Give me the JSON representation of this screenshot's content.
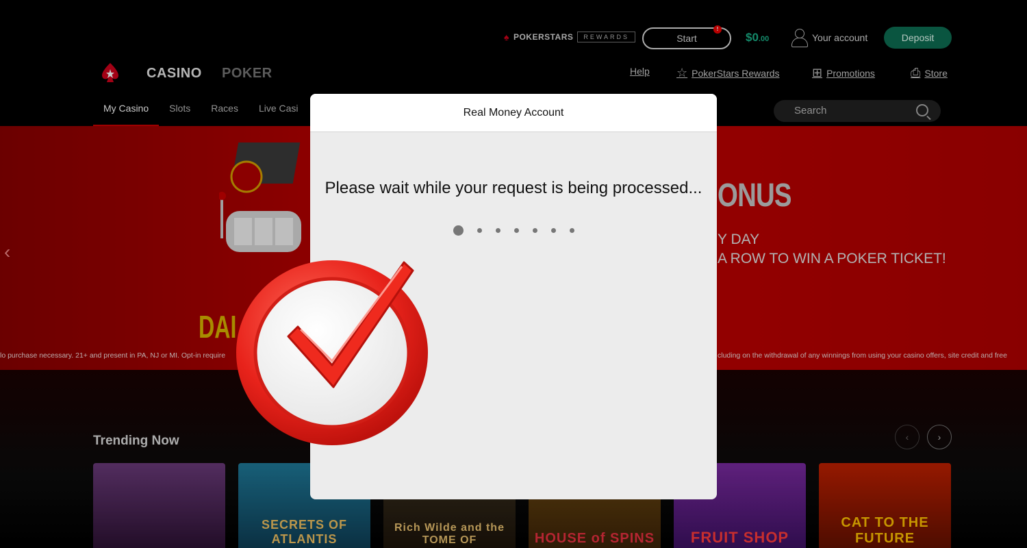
{
  "header": {
    "brand": "POKERSTARS",
    "brand_tag": "REWARDS",
    "start_label": "Start",
    "start_badge": "!",
    "balance_main": "$0",
    "balance_cents": ".00",
    "account_label": "Your account",
    "deposit_label": "Deposit"
  },
  "nav": {
    "casino": "CASINO",
    "poker": "POKER",
    "links": [
      "Help",
      "PokerStars Rewards",
      "Promotions",
      "Store"
    ]
  },
  "subnav": {
    "items": [
      "My Casino",
      "Slots",
      "Races",
      "Live Casi"
    ],
    "search_placeholder": "Search"
  },
  "banner": {
    "heading_partial": "ONUS",
    "line1": "Y DAY",
    "line2": "A ROW TO WIN A POKER TICKET!",
    "daily_partial": "DAI",
    "disclaimer_left": "lo purchase necessary. 21+ and present in PA, NJ or MI. Opt-in require",
    "disclaimer_right": "cluding on the withdrawal of any winnings from using your casino offers, site credit and free"
  },
  "trending": {
    "title": "Trending Now",
    "games": [
      "",
      "SECRETS OF ATLANTIS",
      "Rich Wilde and the TOME OF",
      "HOUSE of SPINS",
      "FRUIT SHOP",
      "CAT TO THE FUTURE"
    ]
  },
  "modal": {
    "title": "Real Money Account",
    "message": "Please wait while your request is being processed..."
  },
  "colors": {
    "brand_red": "#d0021b",
    "balance_green": "#1ab38a",
    "deposit_green": "#0d6e52"
  }
}
